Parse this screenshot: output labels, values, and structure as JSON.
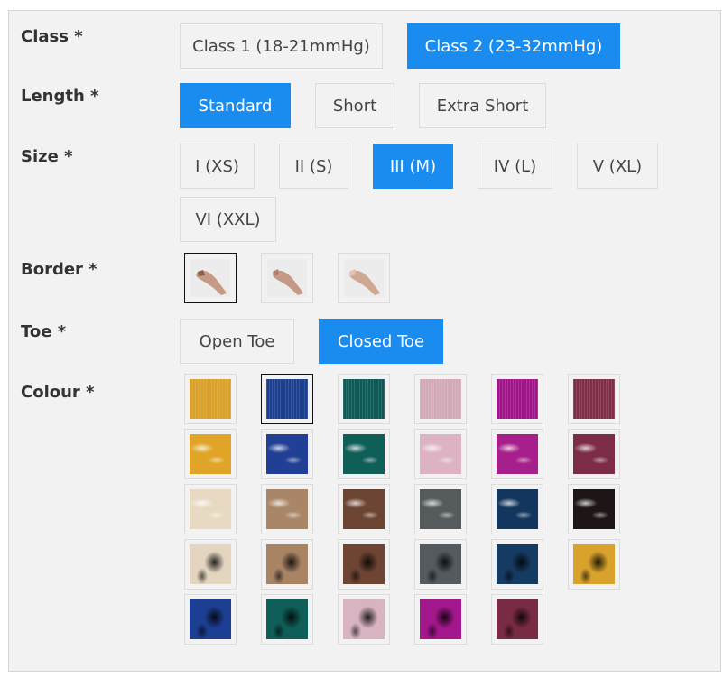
{
  "labels": {
    "class": "Class *",
    "length": "Length *",
    "size": "Size *",
    "border": "Border *",
    "toe": "Toe *",
    "colour": "Colour *"
  },
  "class_options": [
    "Class 1 (18-21mmHg)",
    "Class 2 (23-32mmHg)"
  ],
  "class_selected": "Class 2 (23-32mmHg)",
  "length_options": [
    "Standard",
    "Short",
    "Extra Short"
  ],
  "length_selected": "Standard",
  "size_options": [
    "I (XS)",
    "II (S)",
    "III (M)",
    "IV (L)",
    "V (XL)",
    "VI (XXL)"
  ],
  "size_selected": "III (M)",
  "border_options": [
    "border-style-1",
    "border-style-2",
    "border-style-3"
  ],
  "border_selected": "border-style-1",
  "toe_options": [
    "Open Toe",
    "Closed Toe"
  ],
  "toe_selected": "Closed Toe",
  "accent_color": "#1a8cf0",
  "colour_swatches": [
    {
      "color": "#d9a02a",
      "style": "knit"
    },
    {
      "color": "#1c3f8f",
      "style": "knit",
      "selected": true
    },
    {
      "color": "#0e5a57",
      "style": "knit"
    },
    {
      "color": "#d2aab7",
      "style": "knit"
    },
    {
      "color": "#a0168a",
      "style": "knit"
    },
    {
      "color": "#7e2e45",
      "style": "knit"
    },
    {
      "color": "#e0a526",
      "style": "shine"
    },
    {
      "color": "#213f94",
      "style": "shine"
    },
    {
      "color": "#0f5e57",
      "style": "shine"
    },
    {
      "color": "#ddb3c3",
      "style": "shine"
    },
    {
      "color": "#a61f8a",
      "style": "shine"
    },
    {
      "color": "#7d2c47",
      "style": "shine"
    },
    {
      "color": "#e8d9c2",
      "style": "shine"
    },
    {
      "color": "#a98667",
      "style": "shine"
    },
    {
      "color": "#6b4532",
      "style": "shine"
    },
    {
      "color": "#555a5d",
      "style": "shine"
    },
    {
      "color": "#13365e",
      "style": "shine"
    },
    {
      "color": "#1e1616",
      "style": "shine"
    },
    {
      "color": "#e4d5c0",
      "style": "dark"
    },
    {
      "color": "#a88465",
      "style": "dark"
    },
    {
      "color": "#6e4533",
      "style": "dark"
    },
    {
      "color": "#555a5e",
      "style": "dark"
    },
    {
      "color": "#163b63",
      "style": "dark"
    },
    {
      "color": "#d9a22c",
      "style": "dark"
    },
    {
      "color": "#1c3f93",
      "style": "dark"
    },
    {
      "color": "#0f5e57",
      "style": "dark"
    },
    {
      "color": "#d8b3c1",
      "style": "dark"
    },
    {
      "color": "#a2178b",
      "style": "dark"
    },
    {
      "color": "#7a2b44",
      "style": "dark"
    }
  ]
}
